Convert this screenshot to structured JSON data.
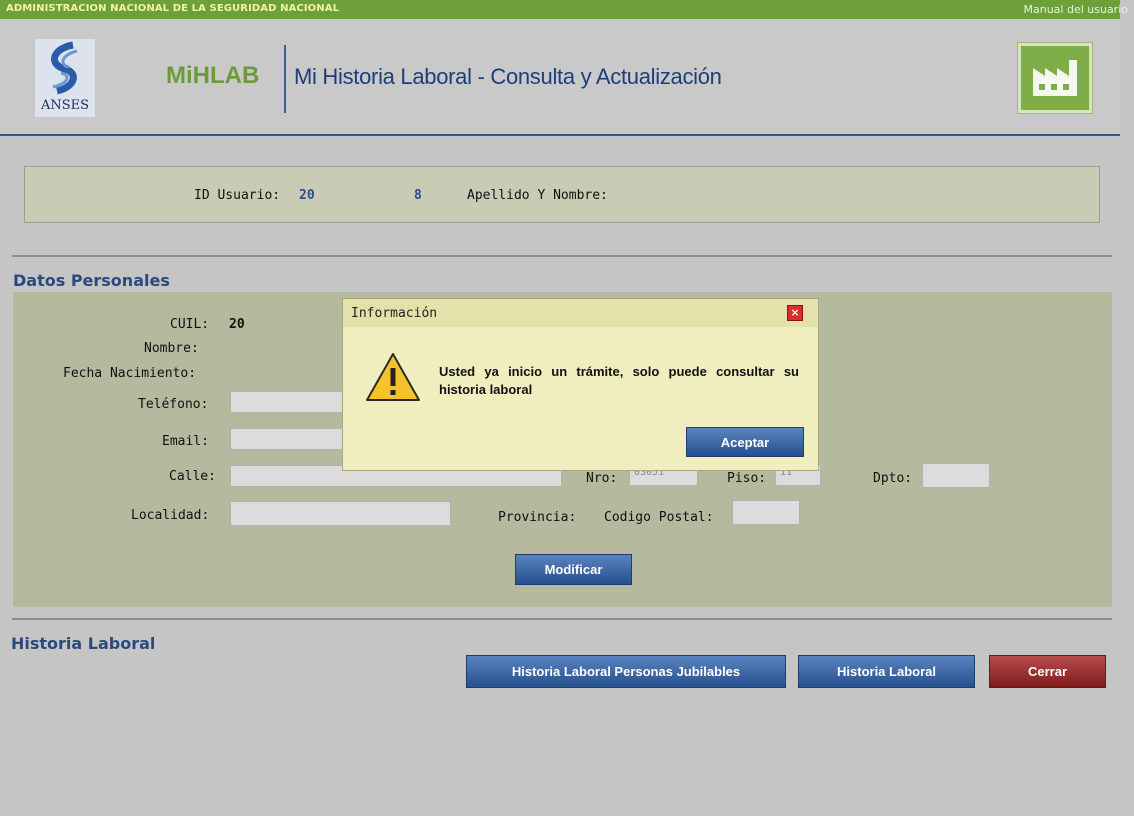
{
  "topbar": {
    "agency": "ADMINISTRACION NACIONAL DE LA SEGURIDAD NACIONAL",
    "manual_link": "Manual del usuario"
  },
  "header": {
    "logo_text": "ANSES",
    "brand": "MiHLAB",
    "title": "Mi Historia Laboral - Consulta y Actualización",
    "factory_icon": "factory-icon"
  },
  "user": {
    "id_label": "ID Usuario:",
    "id_value_1": "20",
    "id_value_2": "8",
    "name_label": "Apellido Y Nombre:"
  },
  "datos_personales": {
    "title": "Datos Personales",
    "cuil_label": "CUIL:",
    "cuil_value": "20",
    "nombre_label": "Nombre:",
    "fecha_label": "Fecha Nacimiento:",
    "telefono_label": "Teléfono:",
    "email_label": "Email:",
    "calle_label": "Calle:",
    "nro_label": "Nro:",
    "nro_value": "03051",
    "piso_label": "Piso:",
    "piso_value": "11",
    "dpto_label": "Dpto:",
    "localidad_label": "Localidad:",
    "provincia_label": "Provincia:",
    "codigo_postal_label": "Codigo Postal:",
    "modificar_label": "Modificar"
  },
  "historia": {
    "title": "Historia Laboral",
    "btn_jubilables": "Historia Laboral Personas Jubilables",
    "btn_historia": "Historia Laboral",
    "btn_cerrar": "Cerrar"
  },
  "dialog": {
    "title": "Información",
    "close_symbol": "×",
    "message": "Usted ya inicio un trámite, solo puede consultar su historia laboral",
    "accept_label": "Aceptar",
    "icon": "warning-icon"
  },
  "colors": {
    "topbar": "#6d9f3a",
    "brand_green": "#6c9c38",
    "navy": "#1e3e7a",
    "panel": "#b5b99d",
    "dialog_bg": "#f0edbf",
    "btn_blue": "#2f5a98",
    "btn_red": "#8c2626"
  }
}
